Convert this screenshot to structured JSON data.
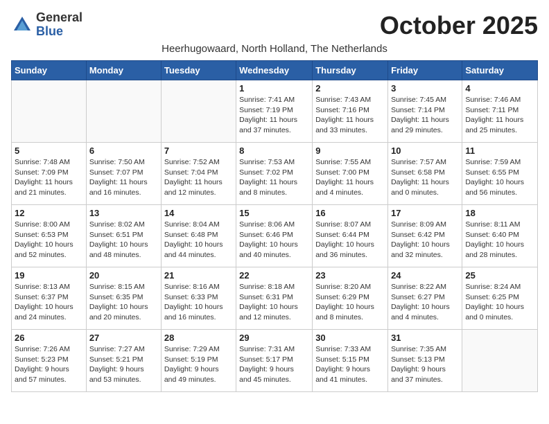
{
  "logo": {
    "general": "General",
    "blue": "Blue"
  },
  "title": "October 2025",
  "subtitle": "Heerhugowaard, North Holland, The Netherlands",
  "days_of_week": [
    "Sunday",
    "Monday",
    "Tuesday",
    "Wednesday",
    "Thursday",
    "Friday",
    "Saturday"
  ],
  "weeks": [
    [
      {
        "day": "",
        "info": ""
      },
      {
        "day": "",
        "info": ""
      },
      {
        "day": "",
        "info": ""
      },
      {
        "day": "1",
        "info": "Sunrise: 7:41 AM\nSunset: 7:19 PM\nDaylight: 11 hours\nand 37 minutes."
      },
      {
        "day": "2",
        "info": "Sunrise: 7:43 AM\nSunset: 7:16 PM\nDaylight: 11 hours\nand 33 minutes."
      },
      {
        "day": "3",
        "info": "Sunrise: 7:45 AM\nSunset: 7:14 PM\nDaylight: 11 hours\nand 29 minutes."
      },
      {
        "day": "4",
        "info": "Sunrise: 7:46 AM\nSunset: 7:11 PM\nDaylight: 11 hours\nand 25 minutes."
      }
    ],
    [
      {
        "day": "5",
        "info": "Sunrise: 7:48 AM\nSunset: 7:09 PM\nDaylight: 11 hours\nand 21 minutes."
      },
      {
        "day": "6",
        "info": "Sunrise: 7:50 AM\nSunset: 7:07 PM\nDaylight: 11 hours\nand 16 minutes."
      },
      {
        "day": "7",
        "info": "Sunrise: 7:52 AM\nSunset: 7:04 PM\nDaylight: 11 hours\nand 12 minutes."
      },
      {
        "day": "8",
        "info": "Sunrise: 7:53 AM\nSunset: 7:02 PM\nDaylight: 11 hours\nand 8 minutes."
      },
      {
        "day": "9",
        "info": "Sunrise: 7:55 AM\nSunset: 7:00 PM\nDaylight: 11 hours\nand 4 minutes."
      },
      {
        "day": "10",
        "info": "Sunrise: 7:57 AM\nSunset: 6:58 PM\nDaylight: 11 hours\nand 0 minutes."
      },
      {
        "day": "11",
        "info": "Sunrise: 7:59 AM\nSunset: 6:55 PM\nDaylight: 10 hours\nand 56 minutes."
      }
    ],
    [
      {
        "day": "12",
        "info": "Sunrise: 8:00 AM\nSunset: 6:53 PM\nDaylight: 10 hours\nand 52 minutes."
      },
      {
        "day": "13",
        "info": "Sunrise: 8:02 AM\nSunset: 6:51 PM\nDaylight: 10 hours\nand 48 minutes."
      },
      {
        "day": "14",
        "info": "Sunrise: 8:04 AM\nSunset: 6:48 PM\nDaylight: 10 hours\nand 44 minutes."
      },
      {
        "day": "15",
        "info": "Sunrise: 8:06 AM\nSunset: 6:46 PM\nDaylight: 10 hours\nand 40 minutes."
      },
      {
        "day": "16",
        "info": "Sunrise: 8:07 AM\nSunset: 6:44 PM\nDaylight: 10 hours\nand 36 minutes."
      },
      {
        "day": "17",
        "info": "Sunrise: 8:09 AM\nSunset: 6:42 PM\nDaylight: 10 hours\nand 32 minutes."
      },
      {
        "day": "18",
        "info": "Sunrise: 8:11 AM\nSunset: 6:40 PM\nDaylight: 10 hours\nand 28 minutes."
      }
    ],
    [
      {
        "day": "19",
        "info": "Sunrise: 8:13 AM\nSunset: 6:37 PM\nDaylight: 10 hours\nand 24 minutes."
      },
      {
        "day": "20",
        "info": "Sunrise: 8:15 AM\nSunset: 6:35 PM\nDaylight: 10 hours\nand 20 minutes."
      },
      {
        "day": "21",
        "info": "Sunrise: 8:16 AM\nSunset: 6:33 PM\nDaylight: 10 hours\nand 16 minutes."
      },
      {
        "day": "22",
        "info": "Sunrise: 8:18 AM\nSunset: 6:31 PM\nDaylight: 10 hours\nand 12 minutes."
      },
      {
        "day": "23",
        "info": "Sunrise: 8:20 AM\nSunset: 6:29 PM\nDaylight: 10 hours\nand 8 minutes."
      },
      {
        "day": "24",
        "info": "Sunrise: 8:22 AM\nSunset: 6:27 PM\nDaylight: 10 hours\nand 4 minutes."
      },
      {
        "day": "25",
        "info": "Sunrise: 8:24 AM\nSunset: 6:25 PM\nDaylight: 10 hours\nand 0 minutes."
      }
    ],
    [
      {
        "day": "26",
        "info": "Sunrise: 7:26 AM\nSunset: 5:23 PM\nDaylight: 9 hours\nand 57 minutes."
      },
      {
        "day": "27",
        "info": "Sunrise: 7:27 AM\nSunset: 5:21 PM\nDaylight: 9 hours\nand 53 minutes."
      },
      {
        "day": "28",
        "info": "Sunrise: 7:29 AM\nSunset: 5:19 PM\nDaylight: 9 hours\nand 49 minutes."
      },
      {
        "day": "29",
        "info": "Sunrise: 7:31 AM\nSunset: 5:17 PM\nDaylight: 9 hours\nand 45 minutes."
      },
      {
        "day": "30",
        "info": "Sunrise: 7:33 AM\nSunset: 5:15 PM\nDaylight: 9 hours\nand 41 minutes."
      },
      {
        "day": "31",
        "info": "Sunrise: 7:35 AM\nSunset: 5:13 PM\nDaylight: 9 hours\nand 37 minutes."
      },
      {
        "day": "",
        "info": ""
      }
    ]
  ]
}
